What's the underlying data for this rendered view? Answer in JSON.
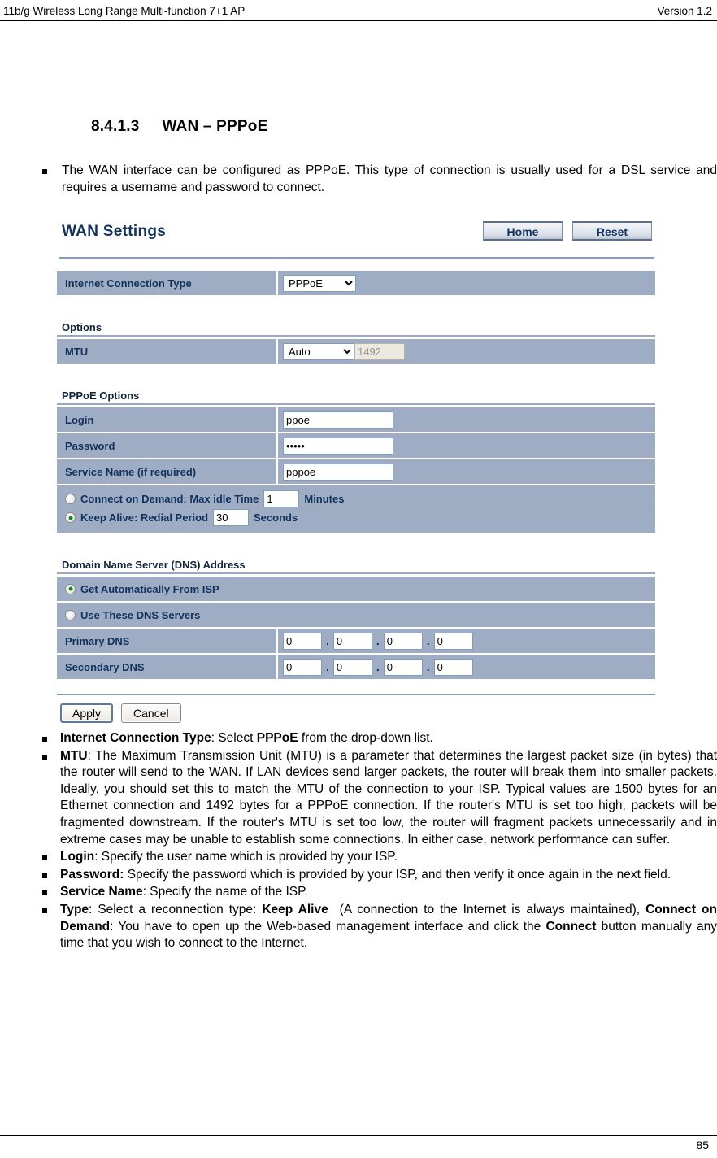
{
  "header": {
    "left": "11b/g Wireless Long Range Multi-function 7+1 AP",
    "right": "Version 1.2"
  },
  "section": {
    "number": "8.4.1.3",
    "title": "WAN – PPPoE",
    "intro": "The WAN interface can be configured as PPPoE. This type of connection is usually used for a DSL service and requires a username and password to connect."
  },
  "router_ui": {
    "title": "WAN Settings",
    "nav": {
      "home": "Home",
      "reset": "Reset"
    },
    "connection": {
      "label": "Internet Connection Type",
      "value": "PPPoE"
    },
    "options": {
      "group_label": "Options",
      "mtu_label": "MTU",
      "mtu_mode": "Auto",
      "mtu_value": "1492"
    },
    "pppoe": {
      "group_label": "PPPoE Options",
      "login_label": "Login",
      "login_value": "ppoe",
      "password_label": "Password",
      "password_value": "•••••",
      "service_label": "Service Name (if required)",
      "service_value": "pppoe",
      "connect_on_demand_label": "Connect on Demand: Max idle Time",
      "connect_on_demand_value": "1",
      "connect_on_demand_unit": "Minutes",
      "connect_on_demand_checked": false,
      "keep_alive_label": "Keep Alive: Redial Period",
      "keep_alive_value": "30",
      "keep_alive_unit": "Seconds",
      "keep_alive_checked": true
    },
    "dns": {
      "group_label": "Domain Name Server (DNS) Address",
      "auto_label": "Get Automatically From ISP",
      "auto_checked": true,
      "manual_label": "Use These DNS Servers",
      "manual_checked": false,
      "primary_label": "Primary DNS",
      "primary_octets": [
        "0",
        "0",
        "0",
        "0"
      ],
      "secondary_label": "Secondary DNS",
      "secondary_octets": [
        "0",
        "0",
        "0",
        "0"
      ],
      "separator": "."
    },
    "actions": {
      "apply": "Apply",
      "cancel": "Cancel"
    },
    "colors": {
      "row_bg": "#9eadc4",
      "label_text": "#12325e",
      "rule": "#8a9bb5",
      "radio_dot": "#1a8a1a"
    }
  },
  "descriptions": [
    {
      "html": "<b>Internet Connection Type</b>: Select <b>PPPoE</b> from the drop-down list."
    },
    {
      "html": "<b>MTU</b>: The Maximum Transmission Unit (MTU) is a parameter that determines the largest packet size (in bytes) that the router will send to the WAN. If LAN devices send larger packets, the router will break them into smaller packets. Ideally, you should set this to match the MTU of the connection to your ISP. Typical values are 1500 bytes for an Ethernet connection and 1492 bytes for a PPPoE connection. If the router's MTU is set too high, packets will be fragmented downstream. If the router's MTU is set too low, the router will fragment packets unnecessarily and in extreme cases may be unable to establish some connections. In either case, network performance can suffer."
    },
    {
      "html": "<b>Login</b>: Specify the user name which is provided by your ISP."
    },
    {
      "html": "<b>Password:</b> Specify the password which is provided by your ISP, and then verify it once again in the next field."
    },
    {
      "html": "<b>Service Name</b>: Specify the name of the ISP."
    },
    {
      "html": "<b>Type</b>: Select a reconnection type: <b>Keep Alive</b>&nbsp; (A connection to the Internet is always maintained), <b>Connect on Demand</b>: You have to open up the Web-based management interface and click the <b>Connect</b> button manually any time that you wish to connect to the Internet."
    }
  ],
  "footer": {
    "page_number": "85"
  }
}
